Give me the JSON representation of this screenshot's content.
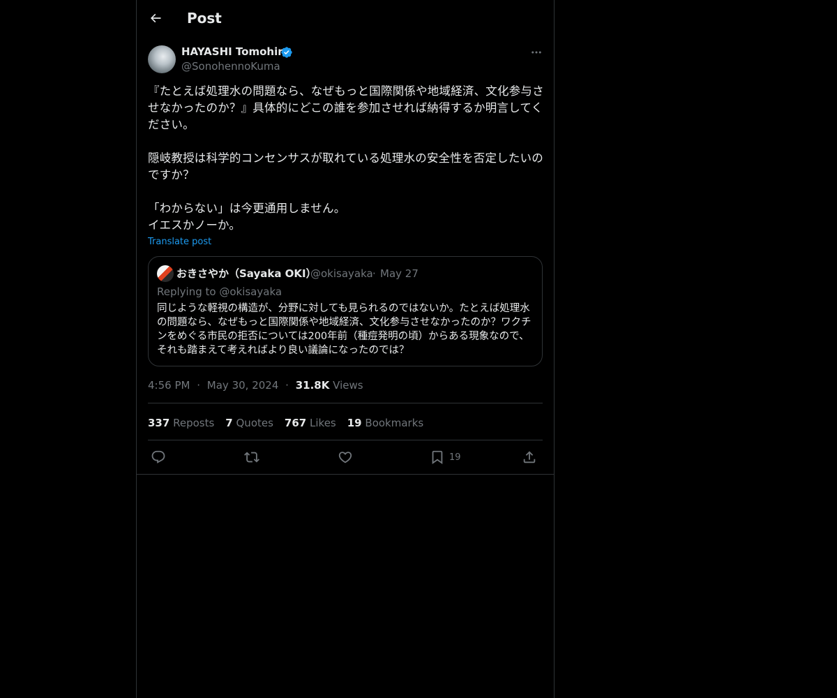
{
  "header": {
    "title": "Post"
  },
  "post": {
    "author_name": "HAYASHI Tomohiro",
    "author_handle": "@SonohennoKuma",
    "text": "『たとえば処理水の問題なら、なぜもっと国際関係や地域経済、文化参与させなかったのか？』具体的にどこの誰を参加させれば納得するか明言してください。\n\n隠岐教授は科学的コンセンサスが取れている処理水の安全性を否定したいのですか？\n\n「わからない」は今更通用しません。\nイエスかノーか。",
    "translate_label": "Translate post",
    "time": "4:56 PM",
    "date": "May 30, 2024",
    "views_count": "31.8K",
    "views_label": "Views",
    "separator": "·"
  },
  "quote": {
    "author_name": "おきさやか（Sayaka OKI）",
    "author_handle": "@okisayaka",
    "date": "May 27",
    "replying_to": "Replying to @okisayaka",
    "text": "同じような軽視の構造が、分野に対しても見られるのではないか。たとえば処理水の問題なら、なぜもっと国際関係や地域経済、文化参与させなかったのか？ワクチンをめぐる市民の拒否については200年前（種痘発明の頃）からある現象なので、それも踏まえて考えればより良い議論になったのでは？"
  },
  "stats": {
    "reposts_count": "337",
    "reposts_label": "Reposts",
    "quotes_count": "7",
    "quotes_label": "Quotes",
    "likes_count": "767",
    "likes_label": "Likes",
    "bookmarks_count": "19",
    "bookmarks_label": "Bookmarks"
  },
  "actions": {
    "bookmark_count": "19",
    "icons": [
      "reply-icon",
      "repost-icon",
      "like-icon",
      "bookmark-icon",
      "share-icon"
    ]
  },
  "colors": {
    "background": "#000000",
    "text_primary": "#e7e9ea",
    "text_secondary": "#71767b",
    "accent": "#1d9bf0",
    "border": "#2f3336"
  }
}
